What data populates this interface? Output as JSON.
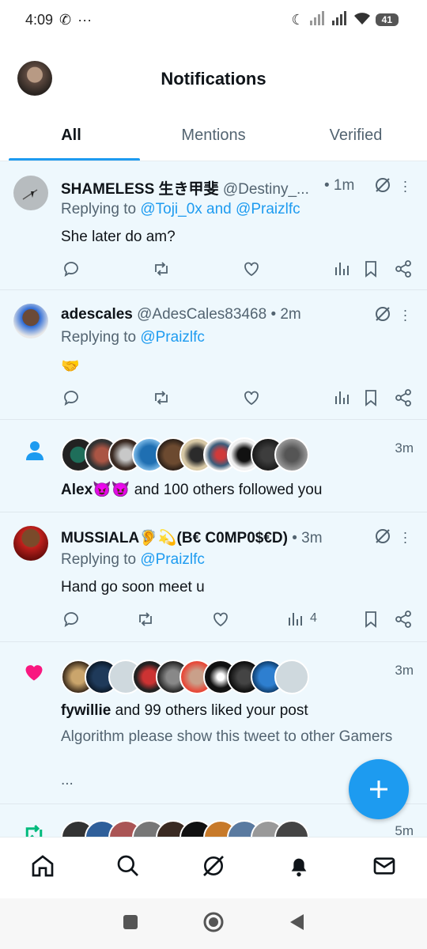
{
  "status_bar": {
    "time": "4:09",
    "battery": "41"
  },
  "header": {
    "title": "Notifications"
  },
  "tabs": [
    {
      "label": "All"
    },
    {
      "label": "Mentions"
    },
    {
      "label": "Verified"
    }
  ],
  "notifications": [
    {
      "name": "SHAMELESS 生き甲斐",
      "handle": "@Destiny_...",
      "time": "• 1m",
      "reply_prefix": "Replying to ",
      "reply_to": "@Toji_0x and @Praizlfc",
      "text": "She later do am?"
    },
    {
      "name": "adescales",
      "handle": "@AdesCales83468",
      "time": "• 2m",
      "reply_prefix": "Replying to ",
      "reply_to": "@Praizlfc",
      "text": "🤝"
    },
    {
      "type": "follow",
      "lead": "Alex😈😈",
      "rest": " and 100 others followed you",
      "time": "3m"
    },
    {
      "name": "MUSSIALA🦻💫(B€ C0MP0$€D)",
      "handle": "",
      "time": "• 3m",
      "reply_prefix": "Replying to ",
      "reply_to": "@Praizlfc",
      "text": "Hand go soon meet u",
      "views": "4"
    },
    {
      "type": "like",
      "lead": "fywillie",
      "rest": " and 99 others liked your post",
      "time": "3m",
      "post": "Algorithm please show this tweet to other Gamers",
      "more": "..."
    },
    {
      "type": "repost",
      "time": "5m"
    }
  ],
  "colors": {
    "accent": "#1d9bf0",
    "like": "#f91880",
    "repost": "#00ba7c",
    "feed_bg": "#eef8fd"
  },
  "icons": [
    "reply-icon",
    "retweet-icon",
    "like-icon",
    "views-icon",
    "bookmark-icon",
    "share-icon",
    "home-icon",
    "search-icon",
    "grok-icon",
    "bell-icon",
    "mail-icon"
  ]
}
